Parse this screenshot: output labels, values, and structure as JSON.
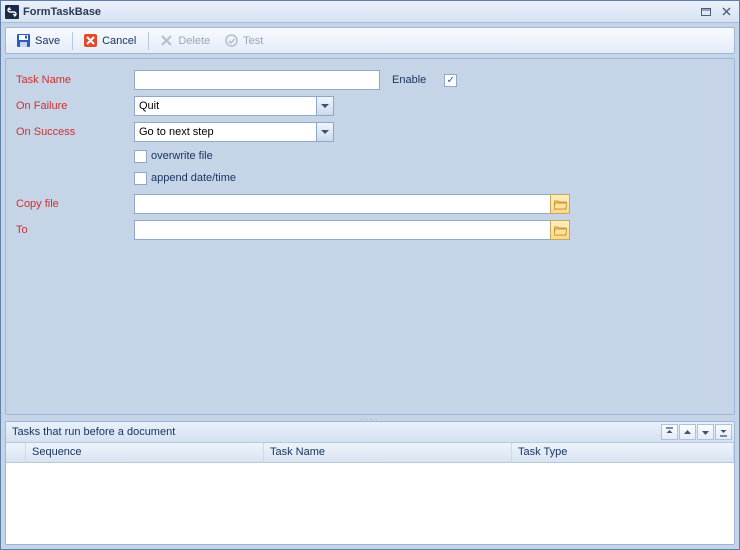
{
  "window": {
    "title": "FormTaskBase"
  },
  "toolbar": {
    "save": "Save",
    "cancel": "Cancel",
    "delete": "Delete",
    "test": "Test",
    "delete_enabled": false,
    "test_enabled": false
  },
  "form": {
    "labels": {
      "task_name": "Task Name",
      "enable": "Enable",
      "on_failure": "On Failure",
      "on_success": "On Success",
      "overwrite_file": "overwrite file",
      "append_datetime": "append date/time",
      "copy_file": "Copy file",
      "to": "To"
    },
    "values": {
      "task_name": "",
      "enable_checked": true,
      "on_failure": "Quit",
      "on_success": "Go to next step",
      "overwrite_checked": false,
      "append_checked": false,
      "copy_file": "",
      "to": ""
    }
  },
  "grid": {
    "title": "Tasks that run before a document",
    "columns": {
      "sequence": "Sequence",
      "task_name": "Task Name",
      "task_type": "Task Type"
    },
    "rows": []
  }
}
